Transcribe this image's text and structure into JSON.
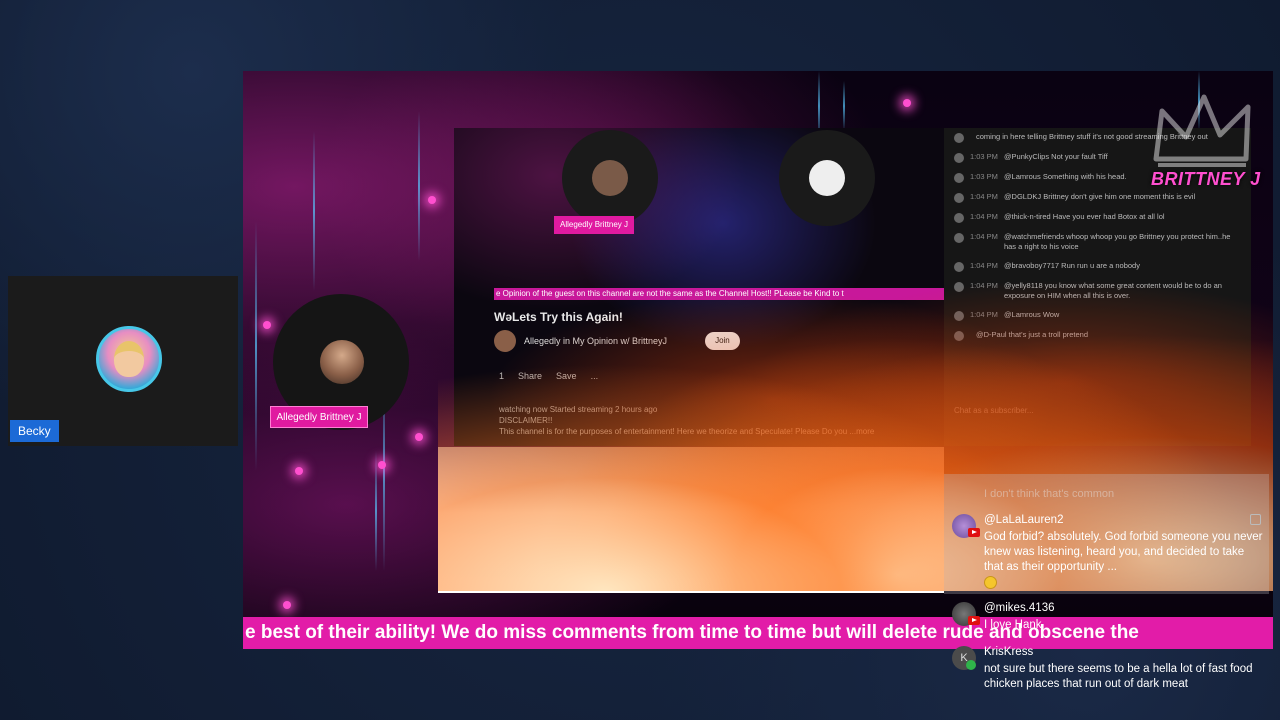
{
  "participant": {
    "name": "Becky"
  },
  "stream": {
    "guest_label": "Allegedly Brittney J",
    "brand": "BRITTNEY J",
    "banner_text": "e best of their ability! We do miss comments from time to time but will delete rude and obscene the"
  },
  "inner_screenshot": {
    "host_pill": "Allegedly Brittney J",
    "ticker": "e Opinion of the guest on this channel are not the same as the Channel Host!! PLease be Kind to t",
    "title": "WəLets Try this Again!",
    "channel_name": "Allegedly in My Opinion w/ BrittneyJ",
    "join_label": "Join",
    "actions": [
      "1",
      "Share",
      "Save",
      "..."
    ],
    "desc_line1": "watching now  Started streaming 2 hours ago",
    "desc_line2": "DISCLAIMER!!",
    "desc_line3": "This channel is for the purposes of entertainment! Here we theorize and Speculate! Please Do you ...more",
    "chat_lines": [
      {
        "time": "",
        "text": "coming in here telling Brittney stuff it's not good streaming Brittney out"
      },
      {
        "time": "1:03 PM",
        "text": "@PunkyClips  Not your fault Tiff"
      },
      {
        "time": "1:03 PM",
        "text": "@Lamrous  Something with his head."
      },
      {
        "time": "1:04 PM",
        "text": "@DGLDKJ  Brittney don't give him one moment this is evil"
      },
      {
        "time": "1:04 PM",
        "text": "@thick-n-tired  Have you ever had Botox at all lol"
      },
      {
        "time": "1:04 PM",
        "text": "@watchmefriends  whoop whoop you go Brittney you protect him..he has a right to his voice"
      },
      {
        "time": "1:04 PM",
        "text": "@bravoboy7717  Run run u are a nobody"
      },
      {
        "time": "1:04 PM",
        "text": "@yelly8118  you know what some great content would be to do an exposure on HIM when all this is over."
      },
      {
        "time": "1:04 PM",
        "text": "@Lamrous  Wow"
      },
      {
        "time": "",
        "text": "@D-Paul  that's just a troll pretend"
      }
    ],
    "chat_input_placeholder": "Chat as a subscriber..."
  },
  "chat": {
    "faded_text": "I don't think that's common",
    "messages": [
      {
        "user": "@LaLaLauren2",
        "text": "God forbid? absolutely. God forbid someone you never knew was listening, heard you, and decided to take that as their opportunity ..."
      },
      {
        "user": "@mikes.4136",
        "text": "I love Hank"
      },
      {
        "user": "KrisKress",
        "text": "not sure but there seems to be a hella lot of fast food chicken places that run out of dark meat"
      }
    ]
  },
  "colors": {
    "accent_pink": "#e21ca8",
    "name_tag_blue": "#1c6ad6",
    "youtube_red": "#e01010"
  }
}
